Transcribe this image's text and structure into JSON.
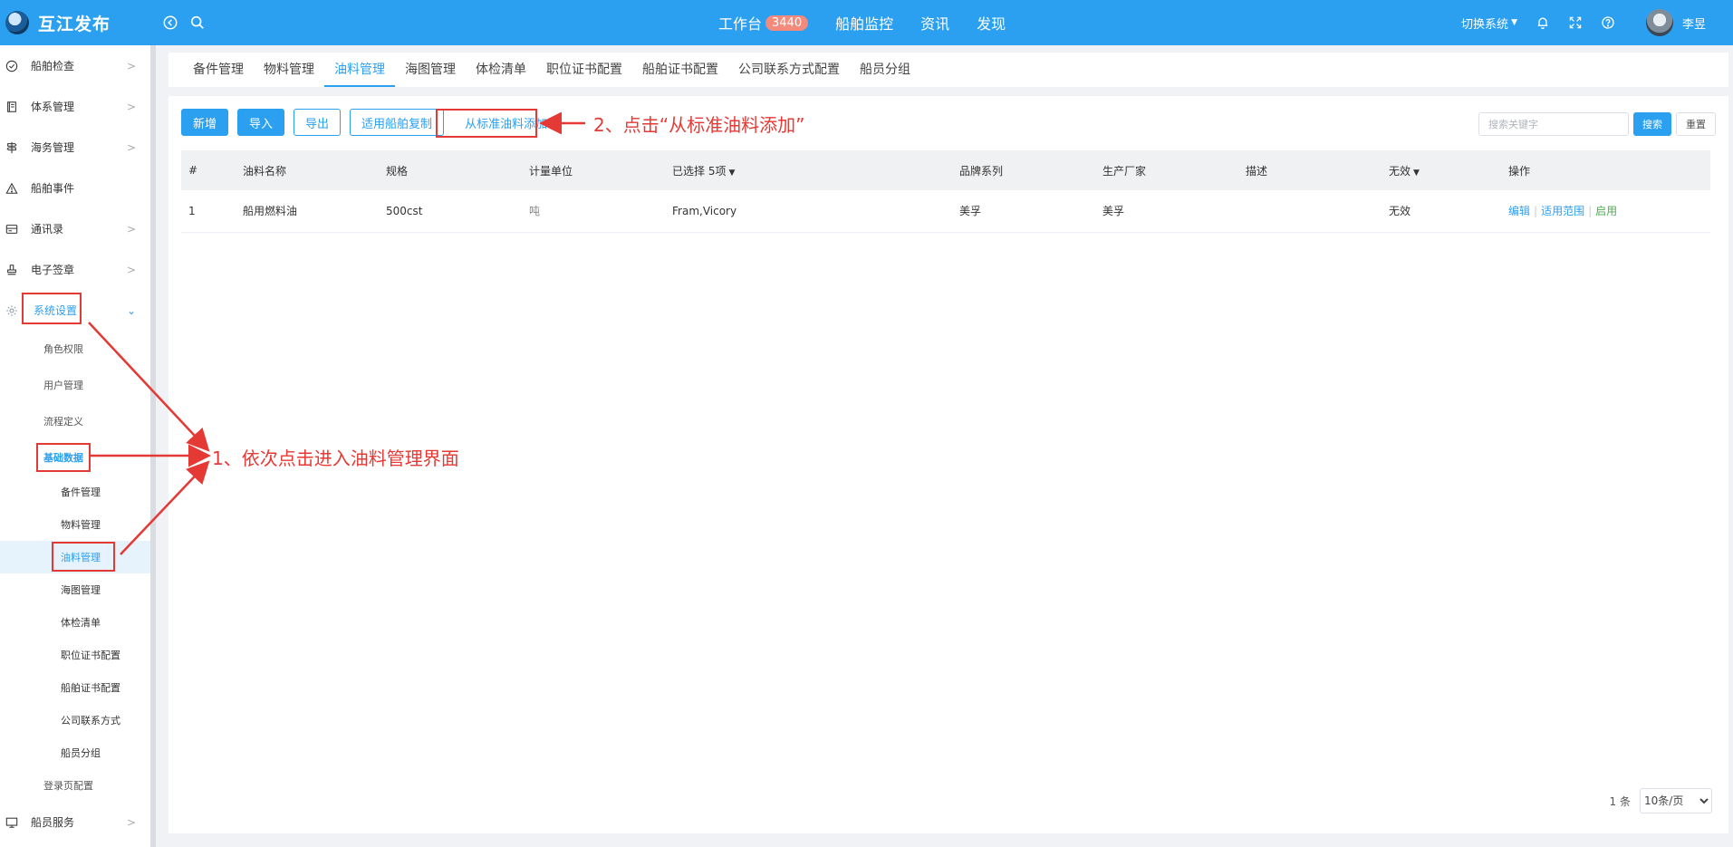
{
  "header": {
    "logo_text": "互江发布",
    "nav": [
      {
        "label": "工作台",
        "badge": "3440"
      },
      {
        "label": "船舶监控"
      },
      {
        "label": "资讯"
      },
      {
        "label": "发现"
      }
    ],
    "switch_system": "切换系统",
    "user_name": "李昱"
  },
  "sidebar": {
    "items": [
      {
        "label": "船舶检查",
        "icon": "check-circle-icon"
      },
      {
        "label": "体系管理",
        "icon": "book-icon"
      },
      {
        "label": "海务管理",
        "icon": "signpost-icon"
      },
      {
        "label": "船舶事件",
        "icon": "warning-icon"
      },
      {
        "label": "通讯录",
        "icon": "address-book-icon"
      },
      {
        "label": "电子签章",
        "icon": "stamp-icon"
      },
      {
        "label": "系统设置",
        "icon": "gear-icon"
      }
    ],
    "system_sub": [
      "角色权限",
      "用户管理",
      "流程定义",
      "基础数据"
    ],
    "basic_sub": [
      "备件管理",
      "物料管理",
      "油料管理",
      "海图管理",
      "体检清单",
      "职位证书配置",
      "船舶证书配置",
      "公司联系方式",
      "船员分组"
    ],
    "login_config": "登录页配置",
    "crew_service": "船员服务"
  },
  "tabs": [
    "备件管理",
    "物料管理",
    "油料管理",
    "海图管理",
    "体检清单",
    "职位证书配置",
    "船舶证书配置",
    "公司联系方式配置",
    "船员分组"
  ],
  "toolbar": {
    "add": "新增",
    "import": "导入",
    "export": "导出",
    "copy": "适用船舶复制",
    "from_std": "从标准油料添加"
  },
  "search": {
    "placeholder": "搜索关键字",
    "search_btn": "搜索",
    "reset_btn": "重置"
  },
  "table": {
    "headers": [
      "#",
      "油料名称",
      "规格",
      "计量单位",
      "已选择 5项",
      "品牌系列",
      "生产厂家",
      "描述",
      "无效",
      "操作"
    ],
    "rows": [
      {
        "idx": "1",
        "name": "船用燃料油",
        "spec": "500cst",
        "unit": "吨",
        "ships": "Fram,Vicory",
        "brand": "美孚",
        "maker": "美孚",
        "desc": "",
        "status": "无效"
      }
    ],
    "ops": [
      "编辑",
      "适用范围",
      "启用"
    ]
  },
  "pager": {
    "total": "1 条",
    "page_size": "10条/页"
  },
  "annotations": {
    "step1": "1、依次点击进入油料管理界面",
    "step2": "2、点击“从标准油料添加”"
  }
}
